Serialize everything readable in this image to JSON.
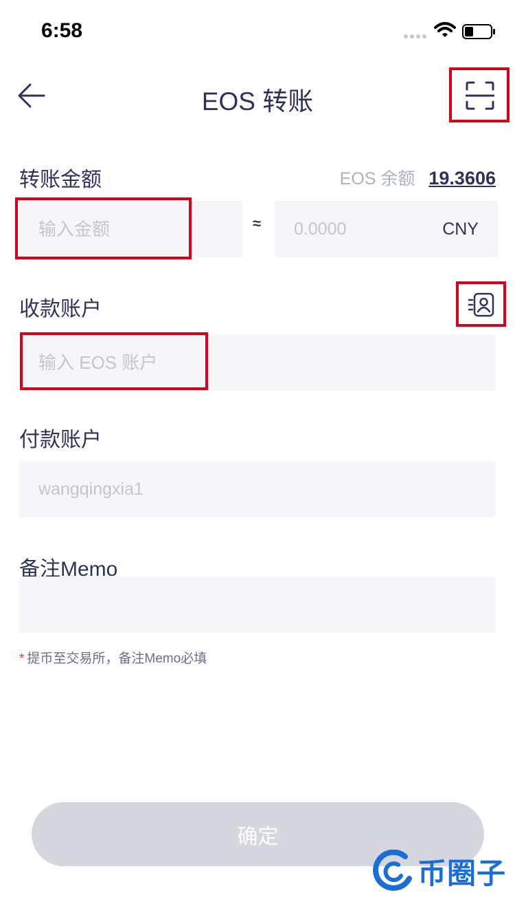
{
  "status_bar": {
    "time": "6:58"
  },
  "nav": {
    "title": "EOS 转账"
  },
  "amount": {
    "label": "转账金额",
    "balance_label": "EOS 余额",
    "balance_value": "19.3606",
    "input_placeholder": "输入金额",
    "approx_symbol": "≈",
    "cny_value": "0.0000",
    "currency": "CNY"
  },
  "receive": {
    "label": "收款账户",
    "input_placeholder": "输入 EOS 账户"
  },
  "pay": {
    "label": "付款账户",
    "value": "wangqingxia1"
  },
  "memo": {
    "label": "备注Memo",
    "note_asterisk": "*",
    "note": "提币至交易所，备注Memo必填"
  },
  "confirm": {
    "label": "确定"
  },
  "watermark": {
    "text": "币圈子"
  },
  "colors": {
    "accent_text": "#2e3259",
    "highlight": "#d9001b",
    "field_bg": "#f6f6f8",
    "button_disabled": "#d6d6de",
    "watermark": "#1a6fd6"
  }
}
